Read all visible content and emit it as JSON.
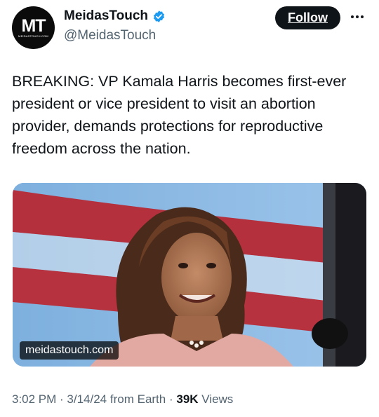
{
  "header": {
    "avatar_monogram": "MT",
    "avatar_subtext": "MEIDASTOUCH.COM",
    "display_name": "MeidasTouch",
    "handle": "@MeidasTouch",
    "follow_label": "Follow",
    "verified_icon": "verified-badge-icon",
    "more_icon": "more-options-icon"
  },
  "tweet": {
    "text": "BREAKING: VP Kamala Harris becomes first-ever president or vice president to visit an abortion provider, demands protections for reproductive freedom across the nation.",
    "media": {
      "link_label": "meidastouch.com"
    }
  },
  "meta": {
    "time": "3:02 PM",
    "sep1": " · ",
    "date": "3/14/24",
    "source": " from Earth",
    "sep2": " · ",
    "views_count": "39K",
    "views_label": " Views"
  },
  "colors": {
    "accent": "#1d9bf0",
    "text": "#0f1419",
    "secondary": "#536471"
  }
}
